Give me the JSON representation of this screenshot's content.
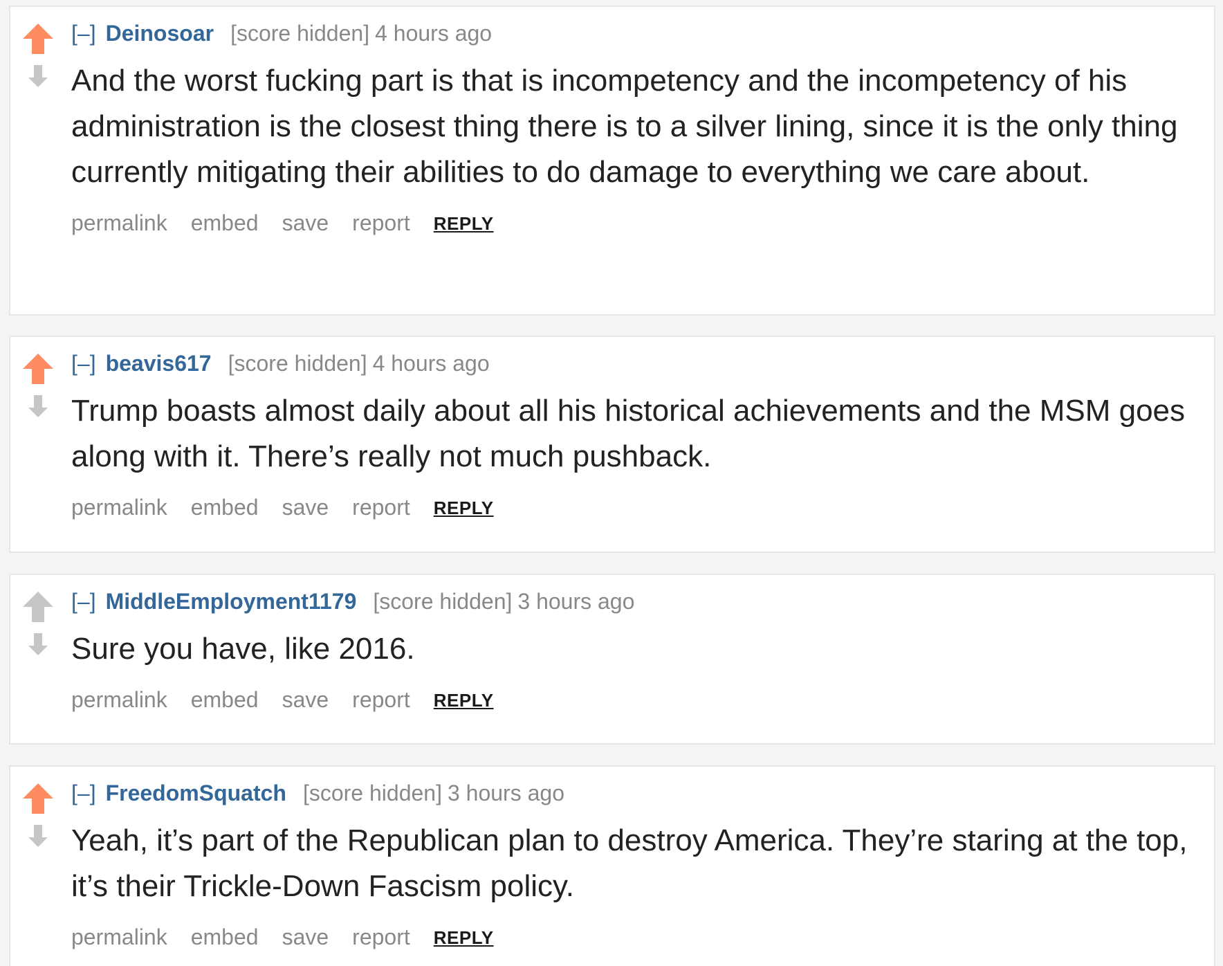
{
  "colors": {
    "upvote_active": "#ff8b60",
    "upvote_inactive": "#c6c6c6",
    "downvote": "#c6c6c6",
    "author": "#336699",
    "meta": "#888888",
    "text": "#222222"
  },
  "comments": [
    {
      "toggle": "[–]",
      "author": "Deinosoar",
      "score": "[score hidden]",
      "time": "4 hours ago",
      "upvoted": true,
      "text": "And the worst fucking part is that is incompetency and the incompetency of his administration is the closest thing there is to a silver lining, since it is the only thing currently mitigating their abilities to do damage to everything we care about.",
      "actions": {
        "permalink": "permalink",
        "embed": "embed",
        "save": "save",
        "report": "report",
        "reply": "REPLY"
      }
    },
    {
      "toggle": "[–]",
      "author": "beavis617",
      "score": "[score hidden]",
      "time": "4 hours ago",
      "upvoted": true,
      "text": "Trump boasts almost daily about all his historical achievements and the MSM goes along with it. There’s really not much pushback.",
      "actions": {
        "permalink": "permalink",
        "embed": "embed",
        "save": "save",
        "report": "report",
        "reply": "REPLY"
      }
    },
    {
      "toggle": "[–]",
      "author": "MiddleEmployment1179",
      "score": "[score hidden]",
      "time": "3 hours ago",
      "upvoted": false,
      "text": "Sure you have, like 2016.",
      "actions": {
        "permalink": "permalink",
        "embed": "embed",
        "save": "save",
        "report": "report",
        "reply": "REPLY"
      }
    },
    {
      "toggle": "[–]",
      "author": "FreedomSquatch",
      "score": "[score hidden]",
      "time": "3 hours ago",
      "upvoted": true,
      "text": "Yeah, it’s part of the Republican plan to destroy America. They’re staring at the top, it’s their Trickle-Down Fascism policy.",
      "actions": {
        "permalink": "permalink",
        "embed": "embed",
        "save": "save",
        "report": "report",
        "reply": "REPLY"
      }
    }
  ]
}
